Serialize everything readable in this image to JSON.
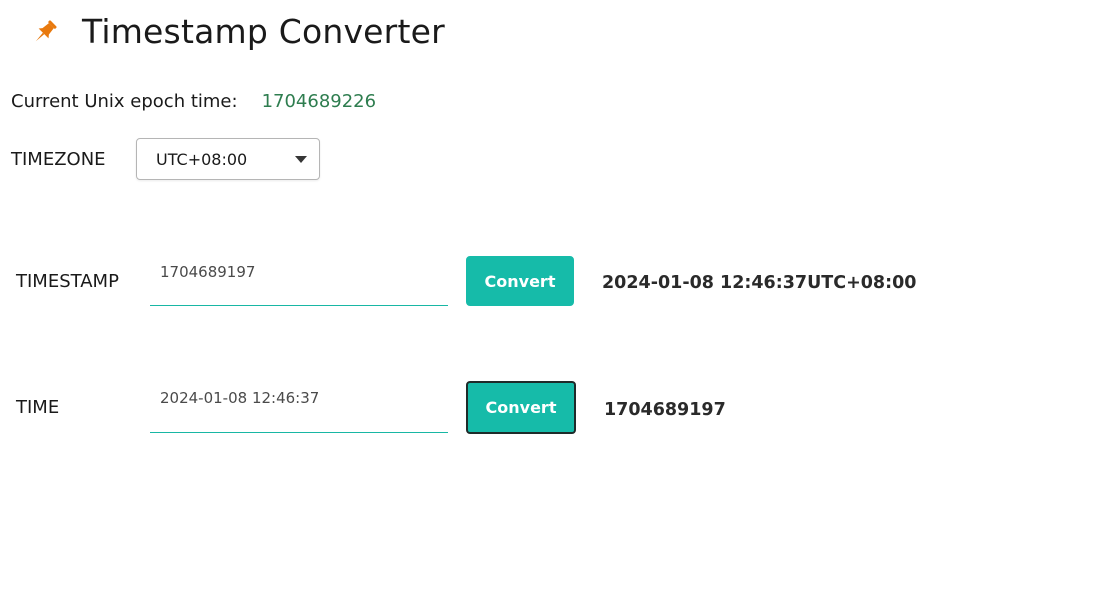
{
  "header": {
    "title": "Timestamp Converter",
    "icon": "pushpin-icon",
    "icon_color": "#e8790e"
  },
  "epoch": {
    "label": "Current Unix epoch time:",
    "value": "1704689226",
    "value_color": "#2e7d4f"
  },
  "timezone": {
    "label": "TIMEZONE",
    "selected": "UTC+08:00"
  },
  "timestamp_row": {
    "label": "TIMESTAMP",
    "input_value": "1704689197",
    "button_label": "Convert",
    "result": "2024-01-08 12:46:37UTC+08:00"
  },
  "time_row": {
    "label": "TIME",
    "input_value": "2024-01-08 12:46:37",
    "button_label": "Convert",
    "result": "1704689197"
  },
  "colors": {
    "accent": "#16bba9"
  }
}
